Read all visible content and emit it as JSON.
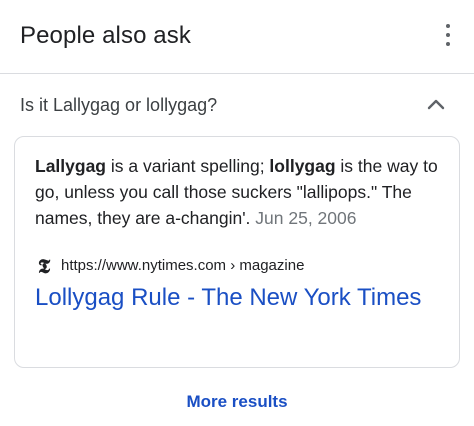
{
  "header": {
    "title": "People also ask",
    "menu_icon": "more-vert-icon"
  },
  "question": {
    "text": "Is it Lallygag or lollygag?",
    "expanded": true,
    "toggle_icon": "chevron-up-icon"
  },
  "answer": {
    "term1": "Lallygag",
    "text1": " is a variant spelling; ",
    "term2": "lollygag",
    "text2": " is the way to go, unless you call those suckers \"lallipops.\" The names, they are a-changin'. ",
    "date": "Jun 25, 2006",
    "source_icon": "nytimes-logo-icon",
    "source_url": "https://www.nytimes.com › magazine",
    "result_title": "Lollygag Rule - The New York Times"
  },
  "footer": {
    "more_results": "More results"
  },
  "colors": {
    "link": "#1a4fc4",
    "divider": "#dadce0",
    "muted": "#70757a"
  }
}
